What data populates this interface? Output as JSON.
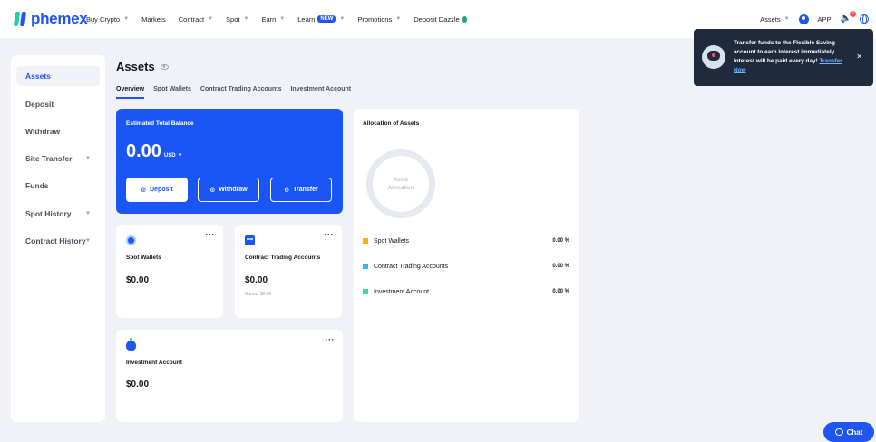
{
  "brand": {
    "name": "phemex"
  },
  "nav": {
    "items": [
      {
        "label": "Buy Crypto",
        "caret": true
      },
      {
        "label": "Markets",
        "caret": false
      },
      {
        "label": "Contract",
        "caret": true
      },
      {
        "label": "Spot",
        "caret": true
      },
      {
        "label": "Earn",
        "caret": true
      },
      {
        "label": "Learn",
        "caret": true,
        "badge": "NEW"
      },
      {
        "label": "Promotions",
        "caret": true
      },
      {
        "label": "Deposit Dazzle",
        "caret": false
      }
    ],
    "right": {
      "assets": "Assets",
      "app": "APP",
      "notifications": "5"
    }
  },
  "sidebar": {
    "items": [
      {
        "label": "Assets",
        "active": true
      },
      {
        "label": "Deposit"
      },
      {
        "label": "Withdraw"
      },
      {
        "label": "Site Transfer",
        "caret": true
      },
      {
        "label": "Funds"
      },
      {
        "label": "Spot History",
        "caret": true
      },
      {
        "label": "Contract History",
        "caret": true
      }
    ]
  },
  "header": {
    "title": "Assets",
    "tabs": [
      "Overview",
      "Spot Wallets",
      "Contract Trading Accounts",
      "Investment Account"
    ]
  },
  "balance": {
    "label": "Estimated Total Balance",
    "value": "0.00",
    "currency": "USD",
    "buttons": {
      "deposit": "Deposit",
      "withdraw": "Withdraw",
      "transfer": "Transfer"
    }
  },
  "cards": {
    "spot": {
      "name": "Spot Wallets",
      "value": "$0.00"
    },
    "contract": {
      "name": "Contract Trading Accounts",
      "value": "$0.00",
      "sub": "Bonus: $0.00"
    },
    "investment": {
      "name": "Investment Account",
      "value": "$0.00"
    }
  },
  "allocation": {
    "title": "Allocation of Assets",
    "ring_label": "Asset Allocation",
    "rows": [
      {
        "name": "Spot Wallets",
        "value": "0.00 %",
        "color": "#f5b400"
      },
      {
        "name": "Contract Trading Accounts",
        "value": "0.00 %",
        "color": "#32b5f0"
      },
      {
        "name": "Investment Account",
        "value": "0.00 %",
        "color": "#3fd99c"
      }
    ]
  },
  "toast": {
    "text": "Transfer funds to the Flexible Saving account to earn interest immediately. Interest will be paid every day!",
    "link": "Transfer Now"
  },
  "chat": {
    "label": "Chat"
  },
  "colors": {
    "brand": "#1f56f1",
    "accent": "#1bd0a6"
  }
}
